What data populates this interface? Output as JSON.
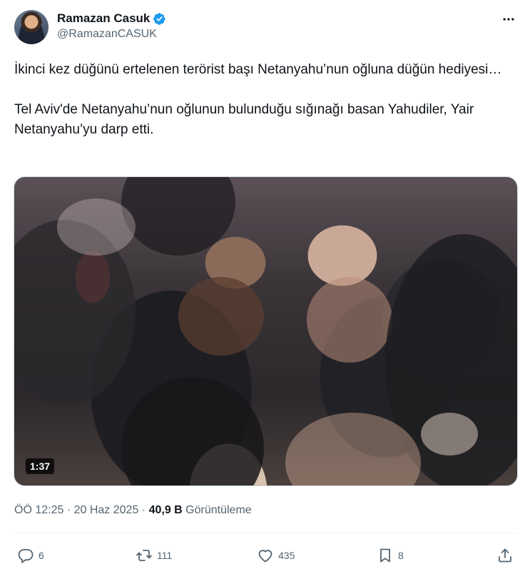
{
  "author": {
    "display_name": "Ramazan Casuk",
    "handle": "@RamazanCASUK",
    "verified": true
  },
  "tweet": {
    "paragraph1": "İkinci kez düğünü ertelenen terörist başı Netanyahu’nun oğluna düğün hediyesi…",
    "paragraph2": "Tel Aviv'de Netanyahu’nun oğlunun bulunduğu sığınağı basan Yahudiler, Yair Netanyahu’yu darp etti."
  },
  "media": {
    "duration": "1:37"
  },
  "meta": {
    "time": "ÖÖ 12:25",
    "separator": "·",
    "date": "20 Haz 2025",
    "views_count": "40,9 B",
    "views_label": "Görüntüleme"
  },
  "actions": {
    "reply_count": "6",
    "retweet_count": "111",
    "like_count": "435",
    "bookmark_count": "8"
  },
  "colors": {
    "verified": "#1d9bf0",
    "secondary_text": "#536471",
    "primary_text": "#0f1419"
  }
}
